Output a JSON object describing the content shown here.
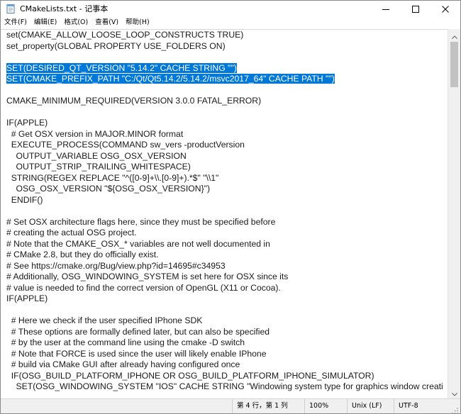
{
  "window": {
    "title": "CMakeLists.txt - 记事本"
  },
  "menu": {
    "items": [
      {
        "label": "文件(F)"
      },
      {
        "label": "编辑(E)"
      },
      {
        "label": "格式(O)"
      },
      {
        "label": "查看(V)"
      },
      {
        "label": "帮助(H)"
      }
    ]
  },
  "editor": {
    "lines": [
      {
        "text": "set(CMAKE_ALLOW_LOOSE_LOOP_CONSTRUCTS TRUE)"
      },
      {
        "text": "set_property(GLOBAL PROPERTY USE_FOLDERS ON)"
      },
      {
        "text": ""
      },
      {
        "text": "SET(DESIRED_QT_VERSION \"5.14.2\" CACHE STRING \"\")",
        "selected": true
      },
      {
        "text": "SET(CMAKE_PREFIX_PATH \"C:/Qt/Qt5.14.2/5.14.2/msvc2017_64\" CACHE PATH \"\")",
        "selected": true
      },
      {
        "text": ""
      },
      {
        "text": "CMAKE_MINIMUM_REQUIRED(VERSION 3.0.0 FATAL_ERROR)"
      },
      {
        "text": ""
      },
      {
        "text": "IF(APPLE)"
      },
      {
        "text": "  # Get OSX version in MAJOR.MINOR format"
      },
      {
        "text": "  EXECUTE_PROCESS(COMMAND sw_vers -productVersion"
      },
      {
        "text": "    OUTPUT_VARIABLE OSG_OSX_VERSION"
      },
      {
        "text": "    OUTPUT_STRIP_TRAILING_WHITESPACE)"
      },
      {
        "text": "  STRING(REGEX REPLACE \"^([0-9]+\\\\.[0-9]+).*$\" \"\\\\1\""
      },
      {
        "text": "    OSG_OSX_VERSION \"${OSG_OSX_VERSION}\")"
      },
      {
        "text": "  ENDIF()"
      },
      {
        "text": ""
      },
      {
        "text": "# Set OSX architecture flags here, since they must be specified before"
      },
      {
        "text": "# creating the actual OSG project."
      },
      {
        "text": "# Note that the CMAKE_OSX_* variables are not well documented in"
      },
      {
        "text": "# CMake 2.8, but they do officially exist."
      },
      {
        "text": "# See https://cmake.org/Bug/view.php?id=14695#c34953"
      },
      {
        "text": "# Additionally, OSG_WINDOWING_SYSTEM is set here for OSX since its"
      },
      {
        "text": "# value is needed to find the correct version of OpenGL (X11 or Cocoa)."
      },
      {
        "text": "IF(APPLE)"
      },
      {
        "text": ""
      },
      {
        "text": "  # Here we check if the user specified IPhone SDK"
      },
      {
        "text": "  # These options are formally defined later, but can also be specified"
      },
      {
        "text": "  # by the user at the command line using the cmake -D switch"
      },
      {
        "text": "  # Note that FORCE is used since the user will likely enable IPhone"
      },
      {
        "text": "  # build via CMake GUI after already having configured once"
      },
      {
        "text": "  IF(OSG_BUILD_PLATFORM_IPHONE OR OSG_BUILD_PLATFORM_IPHONE_SIMULATOR)"
      },
      {
        "text": "    SET(OSG_WINDOWING_SYSTEM \"IOS\" CACHE STRING \"Windowing system type for graphics window creati"
      }
    ]
  },
  "status": {
    "position": "第 4 行，第 1 列",
    "zoom": "100%",
    "line_ending": "Unix (LF)",
    "encoding": "UTF-8"
  },
  "colors": {
    "selection": "#0078d7"
  },
  "icons": {
    "app": "notepad-icon",
    "minimize": "minimize-icon",
    "maximize": "maximize-icon",
    "close": "close-icon"
  }
}
